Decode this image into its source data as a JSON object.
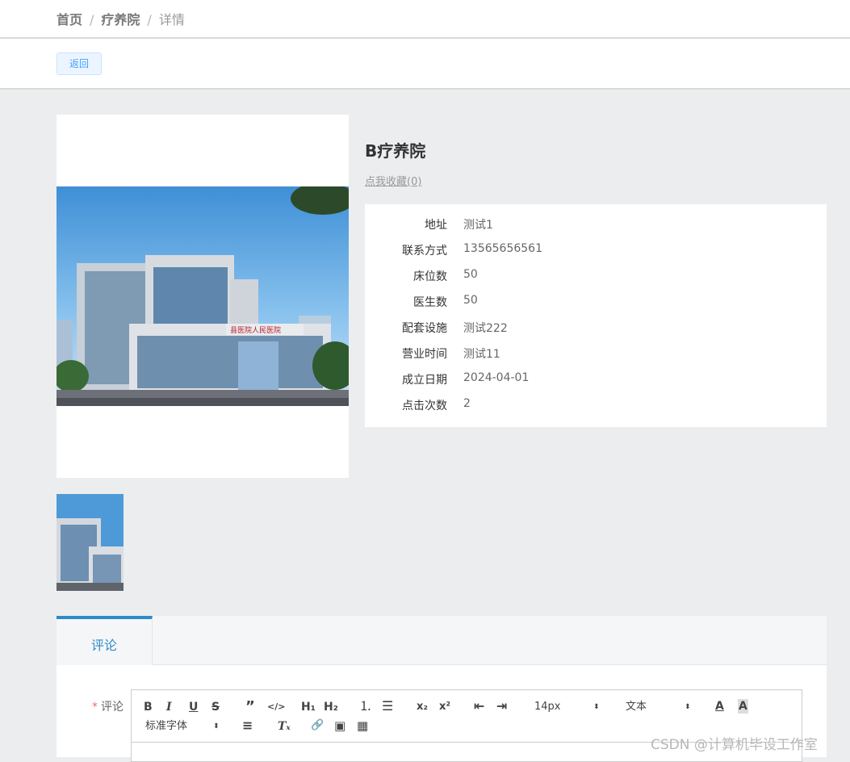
{
  "breadcrumb": {
    "home": "首页",
    "section": "疗养院",
    "current": "详情",
    "separator": "/"
  },
  "toolbar": {
    "back_label": "返回"
  },
  "detail": {
    "title": "B疗养院",
    "favorite_link": "点我收藏(0)",
    "fields": [
      {
        "label": "地址",
        "value": "测试1"
      },
      {
        "label": "联系方式",
        "value": "13565656561"
      },
      {
        "label": "床位数",
        "value": "50"
      },
      {
        "label": "医生数",
        "value": "50"
      },
      {
        "label": "配套设施",
        "value": "测试222"
      },
      {
        "label": "营业时间",
        "value": "测试11"
      },
      {
        "label": "成立日期",
        "value": "2024-04-01"
      },
      {
        "label": "点击次数",
        "value": "2"
      }
    ]
  },
  "tabs": {
    "comment": "评论"
  },
  "comment_form": {
    "required_mark": "*",
    "label": "评论",
    "editor": {
      "font_size": "14px",
      "block_format": "文本",
      "font_family": "标准字体",
      "icons": {
        "bold": "B",
        "italic": "I",
        "underline": "U",
        "strike": "S",
        "blockquote": "”",
        "code": "</>",
        "h1": "H₁",
        "h2": "H₂",
        "ordered_list": "⒈",
        "bullet_list": "☰",
        "subscript": "x₂",
        "superscript": "x²",
        "outdent": "⇤",
        "indent": "⇥",
        "font_color": "A",
        "background": "A",
        "align": "≡",
        "clean": "Tₓ",
        "link": "🔗",
        "image": "▣",
        "video": "▦",
        "picker_arrow": "⬍"
      }
    }
  },
  "watermark": "CSDN @计算机毕设工作室",
  "colors": {
    "accent": "#2e8bc7",
    "button_text": "#409eff",
    "required": "#f56c6c",
    "page_bg": "#ecedef"
  }
}
